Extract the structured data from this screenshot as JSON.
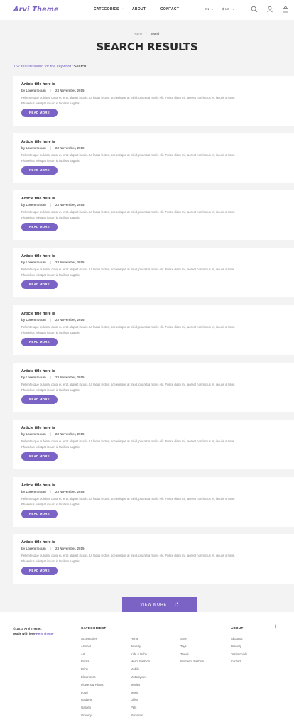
{
  "header": {
    "logo": "Arvi Theme",
    "nav": [
      "CATEGORIES",
      "ABOUT",
      "CONTACT"
    ],
    "language": "EN",
    "currency": "$ US"
  },
  "breadcrumb": {
    "home": "Home",
    "current": "Search"
  },
  "page_title": "SEARCH RESULTS",
  "results": {
    "prefix": "167 results found for the keyword ",
    "keyword": "\"Search\""
  },
  "articles": [
    {
      "title": "Article title here is",
      "author": "by Lorem Ipsum",
      "date": "23 November, 2015",
      "text1": "Pellentesque pulvinar dolor eu erat aliquet iaculis. Ut lacus lectus, scelerisque at mi id, pharetra mollis elit. Fusce diam mi, laoreet non lectus et, iaculis a risus.",
      "text2": "Phasellus volutpat ipsum id facilisis sagittis.",
      "button": "READ MORE"
    },
    {
      "title": "Article title here is",
      "author": "by Lorem Ipsum",
      "date": "23 November, 2015",
      "text1": "Pellentesque pulvinar dolor eu erat aliquet iaculis. Ut lacus lectus, scelerisque at mi id, pharetra mollis elit. Fusce diam mi, laoreet non lectus et, iaculis a risus.",
      "text2": "Phasellus volutpat ipsum id facilisis sagittis.",
      "button": "READ MORE"
    },
    {
      "title": "Article title here is",
      "author": "by Lorem Ipsum",
      "date": "23 November, 2015",
      "text1": "Pellentesque pulvinar dolor eu erat aliquet iaculis. Ut lacus lectus, scelerisque at mi id, pharetra mollis elit. Fusce diam mi, laoreet non lectus et, iaculis a risus.",
      "text2": "Phasellus volutpat ipsum id facilisis sagittis.",
      "button": "READ MORE"
    },
    {
      "title": "Article title here is",
      "author": "by Lorem Ipsum",
      "date": "23 November, 2015",
      "text1": "Pellentesque pulvinar dolor eu erat aliquet iaculis. Ut lacus lectus, scelerisque at mi id, pharetra mollis elit. Fusce diam mi, laoreet non lectus et, iaculis a risus.",
      "text2": "Phasellus volutpat ipsum id facilisis sagittis.",
      "button": "READ MORE"
    },
    {
      "title": "Article title here is",
      "author": "by Lorem Ipsum",
      "date": "23 November, 2015",
      "text1": "Pellentesque pulvinar dolor eu erat aliquet iaculis. Ut lacus lectus, scelerisque at mi id, pharetra mollis elit. Fusce diam mi, laoreet non lectus et, iaculis a risus.",
      "text2": "Phasellus volutpat ipsum id facilisis sagittis.",
      "button": "READ MORE"
    },
    {
      "title": "Article title here is",
      "author": "by Lorem Ipsum",
      "date": "23 November, 2015",
      "text1": "Pellentesque pulvinar dolor eu erat aliquet iaculis. Ut lacus lectus, scelerisque at mi id, pharetra mollis elit. Fusce diam mi, laoreet non lectus et, iaculis a risus.",
      "text2": "Phasellus volutpat ipsum id facilisis sagittis.",
      "button": "READ MORE"
    },
    {
      "title": "Article title here is",
      "author": "by Lorem Ipsum",
      "date": "23 November, 2015",
      "text1": "Pellentesque pulvinar dolor eu erat aliquet iaculis. Ut lacus lectus, scelerisque at mi id, pharetra mollis elit. Fusce diam mi, laoreet non lectus et, iaculis a risus.",
      "text2": "Phasellus volutpat ipsum id facilisis sagittis.",
      "button": "READ MORE"
    },
    {
      "title": "Article title here is",
      "author": "by Lorem Ipsum",
      "date": "23 November, 2015",
      "text1": "Pellentesque pulvinar dolor eu erat aliquet iaculis. Ut lacus lectus, scelerisque at mi id, pharetra mollis elit. Fusce diam mi, laoreet non lectus et, iaculis a risus.",
      "text2": "Phasellus volutpat ipsum id facilisis sagittis.",
      "button": "READ MORE"
    },
    {
      "title": "Article title here is",
      "author": "by Lorem Ipsum",
      "date": "23 November, 2015",
      "text1": "Pellentesque pulvinar dolor eu erat aliquet iaculis. Ut lacus lectus, scelerisque at mi id, pharetra mollis elit. Fusce diam mi, laoreet non lectus et, iaculis a risus.",
      "text2": "Phasellus volutpat ipsum id facilisis sagittis.",
      "button": "READ MORE"
    }
  ],
  "view_more": "VIEW MORE",
  "footer": {
    "copyright": "© 2014 Arvi Theme.",
    "made_with": "Made with love",
    "made_by": "Hery Theme",
    "categories_heading": "CATEGORIEST",
    "col1": [
      "Accessories",
      "Alcohol",
      "Art",
      "Books",
      "Drink",
      "Electronics",
      "Flowers & Plants",
      "Food",
      "Gadgets",
      "Garden",
      "Grocery"
    ],
    "col2": [
      "Home",
      "Jewelry",
      "Kids & Baby",
      "Men's Fashion",
      "Mobile",
      "Motorcycles",
      "Movies",
      "Music",
      "Office",
      "Pets",
      "Romantic"
    ],
    "col3": [
      "Sport",
      "Toys",
      "Travel",
      "Women's Fashion"
    ],
    "about_heading": "ABOUT",
    "about_links": [
      "About us",
      "Delivery",
      "Testimonials",
      "Contact"
    ]
  },
  "colors": {
    "accent": "#7b63c6",
    "background": "#f3f3f4"
  }
}
